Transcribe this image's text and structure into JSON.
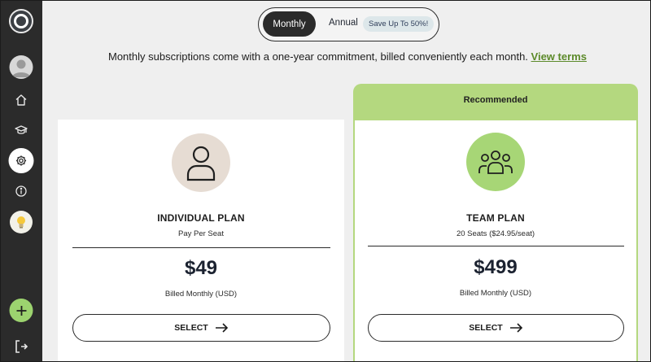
{
  "sidebar": {
    "items": [
      {
        "icon": "logo-icon"
      },
      {
        "icon": "avatar"
      },
      {
        "icon": "home-icon"
      },
      {
        "icon": "graduation-cap-icon"
      },
      {
        "icon": "gear-icon",
        "active": true
      },
      {
        "icon": "info-icon"
      },
      {
        "icon": "lightbulb-icon"
      },
      {
        "icon": "plus-icon"
      },
      {
        "icon": "logout-icon"
      }
    ]
  },
  "billing_toggle": {
    "monthly_label": "Monthly",
    "annual_label": "Annual",
    "save_badge": "Save Up To 50%!",
    "selected": "Monthly"
  },
  "subtitle": {
    "text": "Monthly subscriptions come with a one-year commitment, billed conveniently each month.",
    "link": "View terms"
  },
  "plans": [
    {
      "name": "INDIVIDUAL PLAN",
      "sub": "Pay Per Seat",
      "price": "$49",
      "billing": "Billed Monthly (USD)",
      "button": "SELECT",
      "icon": "user-icon"
    },
    {
      "badge": "Recommended",
      "name": "TEAM PLAN",
      "sub": "20 Seats ($24.95/seat)",
      "price": "$499",
      "billing": "Billed Monthly (USD)",
      "button": "SELECT",
      "icon": "team-icon"
    }
  ],
  "colors": {
    "sidebar": "#2b2b2b",
    "accent_green": "#b4d87f",
    "link_green": "#5c8a2a",
    "individual_icon_bg": "#e6dcd3",
    "team_icon_bg": "#a7d676"
  }
}
